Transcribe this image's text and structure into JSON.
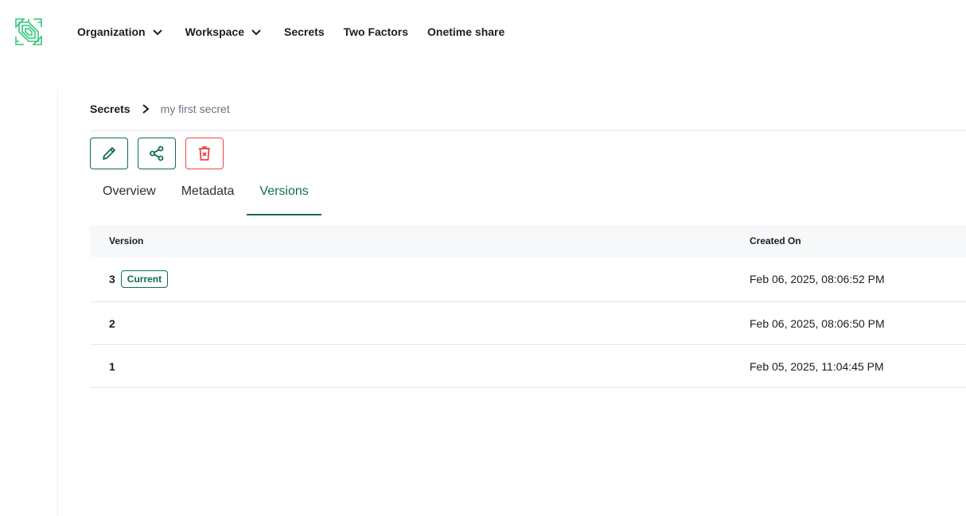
{
  "nav": {
    "items": [
      {
        "label": "Organization",
        "has_dropdown": true
      },
      {
        "label": "Workspace",
        "has_dropdown": true
      },
      {
        "label": "Secrets",
        "has_dropdown": false
      },
      {
        "label": "Two Factors",
        "has_dropdown": false
      },
      {
        "label": "Onetime share",
        "has_dropdown": false
      }
    ],
    "logo_icon": "maze-logo-icon"
  },
  "breadcrumb": {
    "root": "Secrets",
    "current": "my first secret"
  },
  "actions": [
    {
      "name": "edit",
      "icon": "pencil-icon"
    },
    {
      "name": "share",
      "icon": "share-icon"
    },
    {
      "name": "delete",
      "icon": "trash-icon"
    }
  ],
  "tabs": [
    {
      "label": "Overview",
      "active": false
    },
    {
      "label": "Metadata",
      "active": false
    },
    {
      "label": "Versions",
      "active": true
    }
  ],
  "table": {
    "headers": {
      "version": "Version",
      "created_on": "Created On"
    },
    "rows": [
      {
        "version": "3",
        "badge": "Current",
        "created_on": "Feb 06, 2025, 08:06:52 PM"
      },
      {
        "version": "2",
        "badge": "",
        "created_on": "Feb 06, 2025, 08:06:50 PM"
      },
      {
        "version": "1",
        "badge": "",
        "created_on": "Feb 05, 2025, 11:04:45 PM"
      }
    ]
  },
  "colors": {
    "accent": "#0f6e4b",
    "danger": "#ef4444",
    "logo": "#34c77b"
  }
}
